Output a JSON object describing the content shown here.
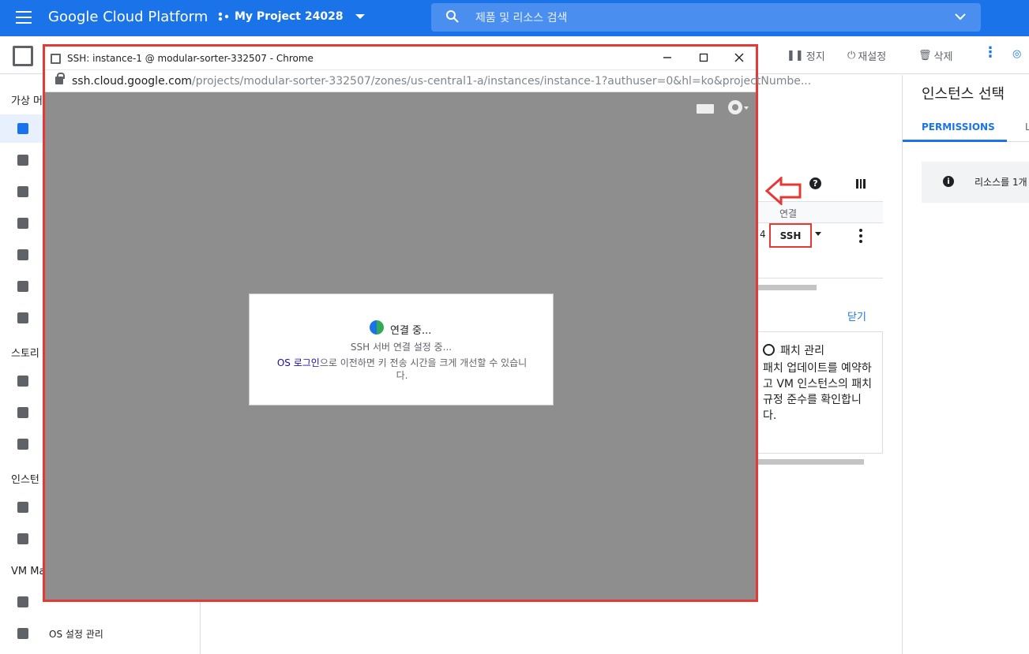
{
  "topbar": {
    "brand": "Google Cloud Platform",
    "project": "My Project 24028",
    "search_placeholder": "제품 및 리소스 검색"
  },
  "toolbar": {
    "stop_label": "정지",
    "reset_label": "재설정",
    "delete_label": "삭제"
  },
  "nav": {
    "sections": [
      "가상 머",
      "스토리",
      "인스턴",
      "VM Ma"
    ],
    "items": [
      {
        "label": "OS 설정 관리"
      }
    ]
  },
  "main": {
    "connect_header": "연결",
    "ssh_label": "SSH",
    "cell_value": "4",
    "close_link": "닫기",
    "patch_title": "패치 관리",
    "patch_desc": "패치 업데이트를 예약하고 VM 인스턴스의 패치 규정 준수를 확인합니다."
  },
  "right_panel": {
    "title": "인스턴스 선택",
    "tab_permissions": "PERMISSIONS",
    "tab_second": "L",
    "info_text": "리소스를 1개"
  },
  "popup": {
    "window_title": "SSH: instance-1 @ modular-sorter-332507 - Chrome",
    "url_host": "ssh.cloud.google.com",
    "url_path": "/projects/modular-sorter-332507/zones/us-central1-a/instances/instance-1?authuser=0&hl=ko&projectNumbe...",
    "dialog_title": "연결 중...",
    "dialog_sub": "SSH 서버 연결 설정 중...",
    "dialog_note_link": "OS 로그인",
    "dialog_note_rest": "으로 이전하면 키 전송 시간을 크게 개선할 수 있습니다."
  },
  "colors": {
    "brand_blue": "#1a73e8",
    "highlight_red": "#e53935",
    "terminal_gray": "#8e8e8e"
  }
}
